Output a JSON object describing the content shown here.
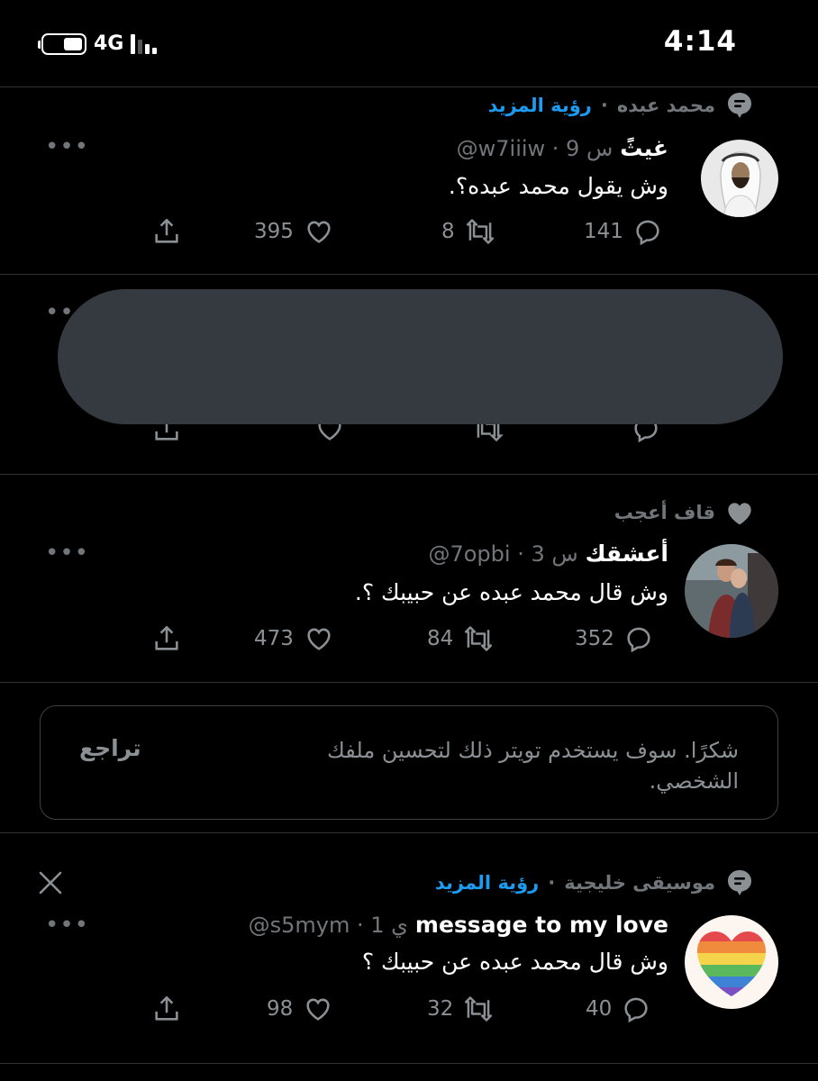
{
  "status_bar": {
    "time": "4:14",
    "network": "4G"
  },
  "tweets": [
    {
      "context": {
        "label": "محمد عبده",
        "link": "رؤية المزيد",
        "icon": "topic-icon"
      },
      "author_name": "غيثً",
      "meta": "@w7iiiw · 9 س",
      "text": "وش يقول محمد عبده؟.",
      "replies": "141",
      "retweets": "8",
      "likes": "395"
    },
    {
      "hidden": true
    },
    {
      "context": {
        "label": "قاف أعجب",
        "icon": "heart-icon"
      },
      "author_name": "أعشقك",
      "meta": "@7opbi · 3 س",
      "text": "وش قال محمد عبده عن حبيبك ؟.",
      "replies": "352",
      "retweets": "84",
      "likes": "473"
    },
    {
      "context": {
        "label": "موسيقى خليجية",
        "link": "رؤية المزيد",
        "icon": "topic-icon"
      },
      "author_name": "message to my love",
      "meta": "@s5mym · 1 ي",
      "text": "وش قال محمد عبده عن حبيبك ؟",
      "replies": "40",
      "retweets": "32",
      "likes": "98"
    }
  ],
  "feedback_notice": {
    "text": "شكرًا. سوف يستخدم تويتر ذلك لتحسين ملفك الشخصي.",
    "undo_label": "تراجع"
  },
  "colors": {
    "background": "#000000",
    "accent": "#1d9bf0",
    "muted": "#71767b",
    "redaction": "#353a40"
  }
}
